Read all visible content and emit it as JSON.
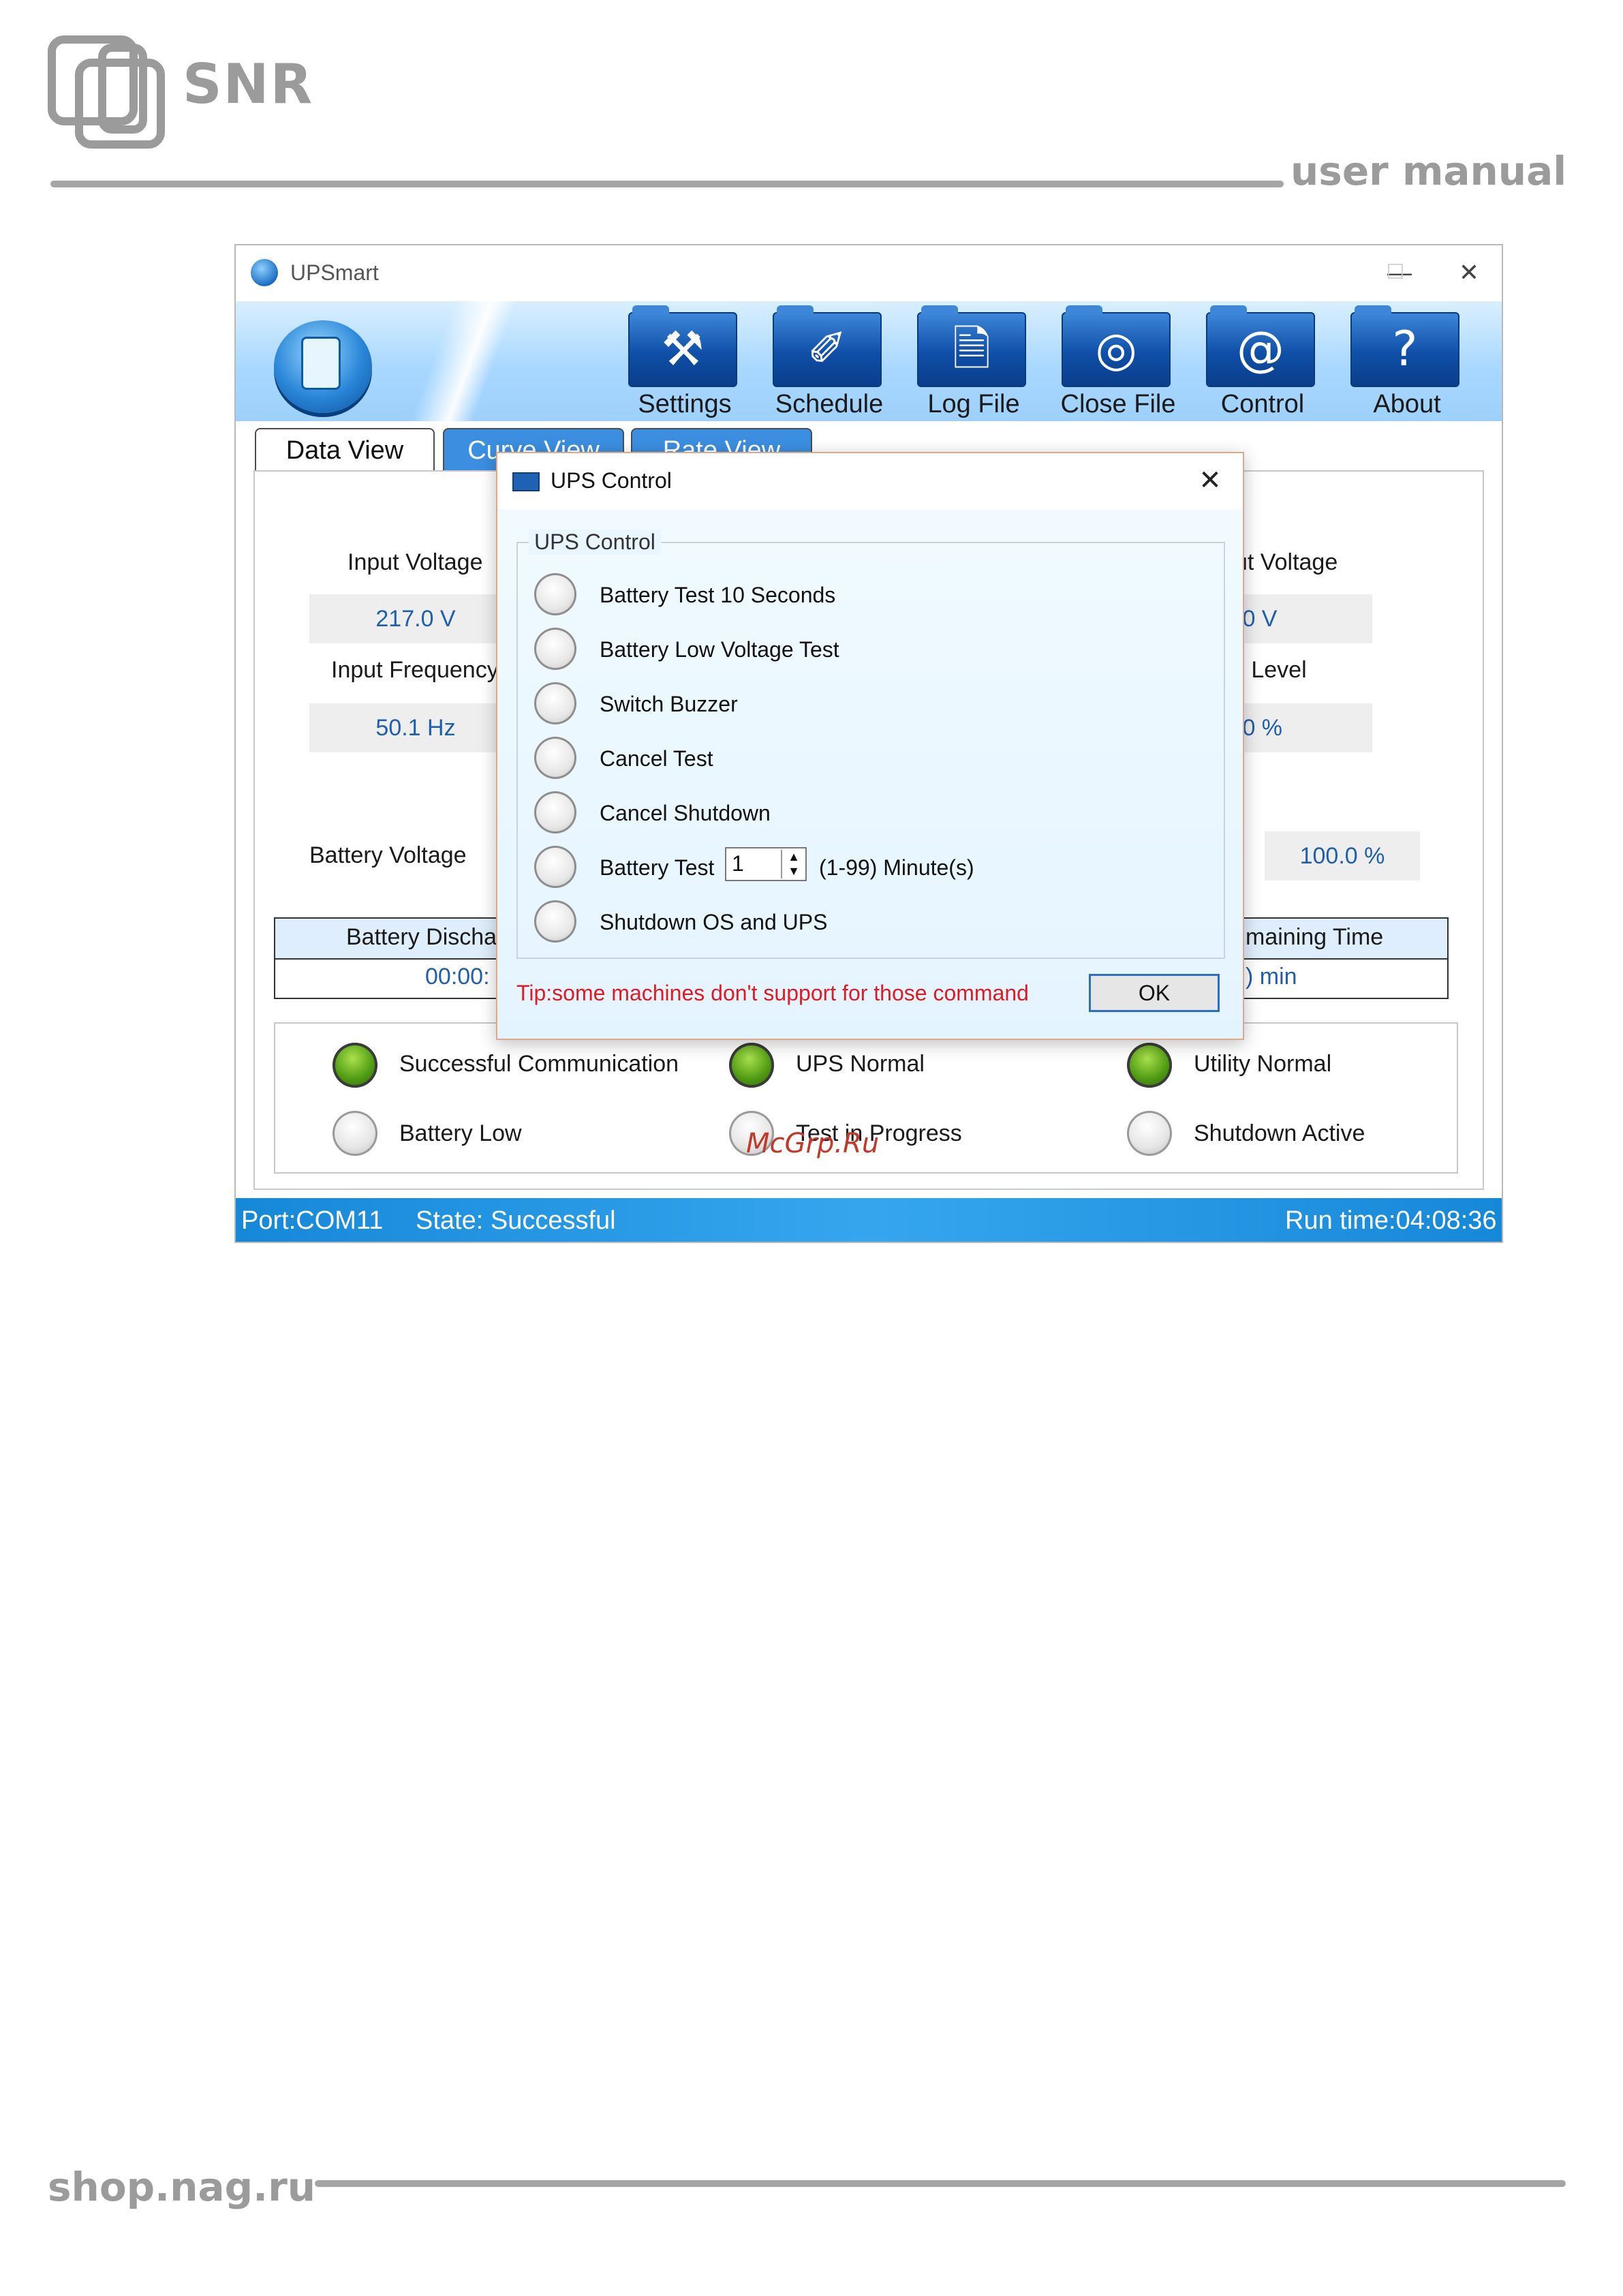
{
  "manual": {
    "brand": "SNR",
    "header_text": "user manual",
    "footer_text": "shop.nag.ru",
    "watermark": "McGrp.Ru"
  },
  "window": {
    "title": "UPSmart",
    "toolbar": [
      {
        "label": "Settings",
        "icon": "hammer-icon"
      },
      {
        "label": "Schedule",
        "icon": "schedule-icon"
      },
      {
        "label": "Log File",
        "icon": "document-icon"
      },
      {
        "label": "Close File",
        "icon": "disc-icon"
      },
      {
        "label": "Control",
        "icon": "at-icon"
      },
      {
        "label": "About",
        "icon": "question-icon"
      }
    ],
    "tabs": [
      "Data View",
      "Curve View",
      "Rate View"
    ],
    "data": {
      "input_voltage_label": "Input Voltage",
      "input_voltage_value": "217.0 V",
      "input_frequency_label": "Input Frequency",
      "input_frequency_value": "50.1 Hz",
      "output_voltage_label": "ut Voltage",
      "output_voltage_value": ".0 V",
      "load_level_label": "d Level",
      "load_level_value": ".0 %",
      "battery_voltage_label": "Battery Voltage",
      "battery_capacity_value": "100.0 %",
      "discharge_header": "Battery Discha",
      "discharge_value": "00:00:",
      "remaining_header": "maining Time",
      "remaining_value": ") min"
    },
    "status": [
      {
        "label": "Successful Communication",
        "on": true
      },
      {
        "label": "UPS Normal",
        "on": true
      },
      {
        "label": "Utility Normal",
        "on": true
      },
      {
        "label": "Battery Low",
        "on": false
      },
      {
        "label": "Test in Progress",
        "on": false
      },
      {
        "label": "Shutdown Active",
        "on": false
      }
    ],
    "statusbar": {
      "port": "Port:COM11",
      "state": "State: Successful",
      "runtime": "Run time:04:08:36"
    }
  },
  "dialog": {
    "title": "UPS Control",
    "group_title": "UPS Control",
    "options": [
      "Battery Test 10 Seconds",
      "Battery Low Voltage Test",
      "Switch Buzzer",
      "Cancel Test",
      "Cancel Shutdown",
      "Battery Test",
      "Shutdown OS and UPS"
    ],
    "battery_test_minutes": "1",
    "battery_test_range": "(1-99) Minute(s)",
    "tip": "Tip:some machines don't support for those command",
    "ok_label": "OK"
  }
}
